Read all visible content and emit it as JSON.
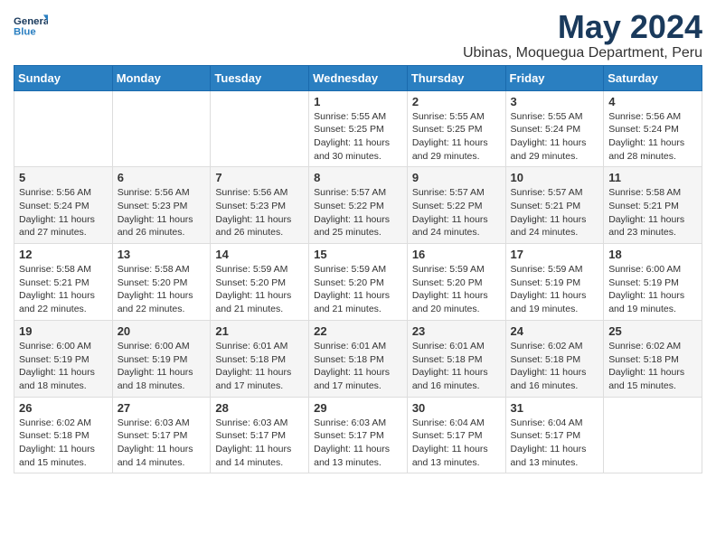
{
  "header": {
    "logo_general": "General",
    "logo_blue": "Blue",
    "month_title": "May 2024",
    "location": "Ubinas, Moquegua Department, Peru"
  },
  "weekdays": [
    "Sunday",
    "Monday",
    "Tuesday",
    "Wednesday",
    "Thursday",
    "Friday",
    "Saturday"
  ],
  "weeks": [
    [
      {
        "day": "",
        "info": ""
      },
      {
        "day": "",
        "info": ""
      },
      {
        "day": "",
        "info": ""
      },
      {
        "day": "1",
        "info": "Sunrise: 5:55 AM\nSunset: 5:25 PM\nDaylight: 11 hours\nand 30 minutes."
      },
      {
        "day": "2",
        "info": "Sunrise: 5:55 AM\nSunset: 5:25 PM\nDaylight: 11 hours\nand 29 minutes."
      },
      {
        "day": "3",
        "info": "Sunrise: 5:55 AM\nSunset: 5:24 PM\nDaylight: 11 hours\nand 29 minutes."
      },
      {
        "day": "4",
        "info": "Sunrise: 5:56 AM\nSunset: 5:24 PM\nDaylight: 11 hours\nand 28 minutes."
      }
    ],
    [
      {
        "day": "5",
        "info": "Sunrise: 5:56 AM\nSunset: 5:24 PM\nDaylight: 11 hours\nand 27 minutes."
      },
      {
        "day": "6",
        "info": "Sunrise: 5:56 AM\nSunset: 5:23 PM\nDaylight: 11 hours\nand 26 minutes."
      },
      {
        "day": "7",
        "info": "Sunrise: 5:56 AM\nSunset: 5:23 PM\nDaylight: 11 hours\nand 26 minutes."
      },
      {
        "day": "8",
        "info": "Sunrise: 5:57 AM\nSunset: 5:22 PM\nDaylight: 11 hours\nand 25 minutes."
      },
      {
        "day": "9",
        "info": "Sunrise: 5:57 AM\nSunset: 5:22 PM\nDaylight: 11 hours\nand 24 minutes."
      },
      {
        "day": "10",
        "info": "Sunrise: 5:57 AM\nSunset: 5:21 PM\nDaylight: 11 hours\nand 24 minutes."
      },
      {
        "day": "11",
        "info": "Sunrise: 5:58 AM\nSunset: 5:21 PM\nDaylight: 11 hours\nand 23 minutes."
      }
    ],
    [
      {
        "day": "12",
        "info": "Sunrise: 5:58 AM\nSunset: 5:21 PM\nDaylight: 11 hours\nand 22 minutes."
      },
      {
        "day": "13",
        "info": "Sunrise: 5:58 AM\nSunset: 5:20 PM\nDaylight: 11 hours\nand 22 minutes."
      },
      {
        "day": "14",
        "info": "Sunrise: 5:59 AM\nSunset: 5:20 PM\nDaylight: 11 hours\nand 21 minutes."
      },
      {
        "day": "15",
        "info": "Sunrise: 5:59 AM\nSunset: 5:20 PM\nDaylight: 11 hours\nand 21 minutes."
      },
      {
        "day": "16",
        "info": "Sunrise: 5:59 AM\nSunset: 5:20 PM\nDaylight: 11 hours\nand 20 minutes."
      },
      {
        "day": "17",
        "info": "Sunrise: 5:59 AM\nSunset: 5:19 PM\nDaylight: 11 hours\nand 19 minutes."
      },
      {
        "day": "18",
        "info": "Sunrise: 6:00 AM\nSunset: 5:19 PM\nDaylight: 11 hours\nand 19 minutes."
      }
    ],
    [
      {
        "day": "19",
        "info": "Sunrise: 6:00 AM\nSunset: 5:19 PM\nDaylight: 11 hours\nand 18 minutes."
      },
      {
        "day": "20",
        "info": "Sunrise: 6:00 AM\nSunset: 5:19 PM\nDaylight: 11 hours\nand 18 minutes."
      },
      {
        "day": "21",
        "info": "Sunrise: 6:01 AM\nSunset: 5:18 PM\nDaylight: 11 hours\nand 17 minutes."
      },
      {
        "day": "22",
        "info": "Sunrise: 6:01 AM\nSunset: 5:18 PM\nDaylight: 11 hours\nand 17 minutes."
      },
      {
        "day": "23",
        "info": "Sunrise: 6:01 AM\nSunset: 5:18 PM\nDaylight: 11 hours\nand 16 minutes."
      },
      {
        "day": "24",
        "info": "Sunrise: 6:02 AM\nSunset: 5:18 PM\nDaylight: 11 hours\nand 16 minutes."
      },
      {
        "day": "25",
        "info": "Sunrise: 6:02 AM\nSunset: 5:18 PM\nDaylight: 11 hours\nand 15 minutes."
      }
    ],
    [
      {
        "day": "26",
        "info": "Sunrise: 6:02 AM\nSunset: 5:18 PM\nDaylight: 11 hours\nand 15 minutes."
      },
      {
        "day": "27",
        "info": "Sunrise: 6:03 AM\nSunset: 5:17 PM\nDaylight: 11 hours\nand 14 minutes."
      },
      {
        "day": "28",
        "info": "Sunrise: 6:03 AM\nSunset: 5:17 PM\nDaylight: 11 hours\nand 14 minutes."
      },
      {
        "day": "29",
        "info": "Sunrise: 6:03 AM\nSunset: 5:17 PM\nDaylight: 11 hours\nand 13 minutes."
      },
      {
        "day": "30",
        "info": "Sunrise: 6:04 AM\nSunset: 5:17 PM\nDaylight: 11 hours\nand 13 minutes."
      },
      {
        "day": "31",
        "info": "Sunrise: 6:04 AM\nSunset: 5:17 PM\nDaylight: 11 hours\nand 13 minutes."
      },
      {
        "day": "",
        "info": ""
      }
    ]
  ]
}
